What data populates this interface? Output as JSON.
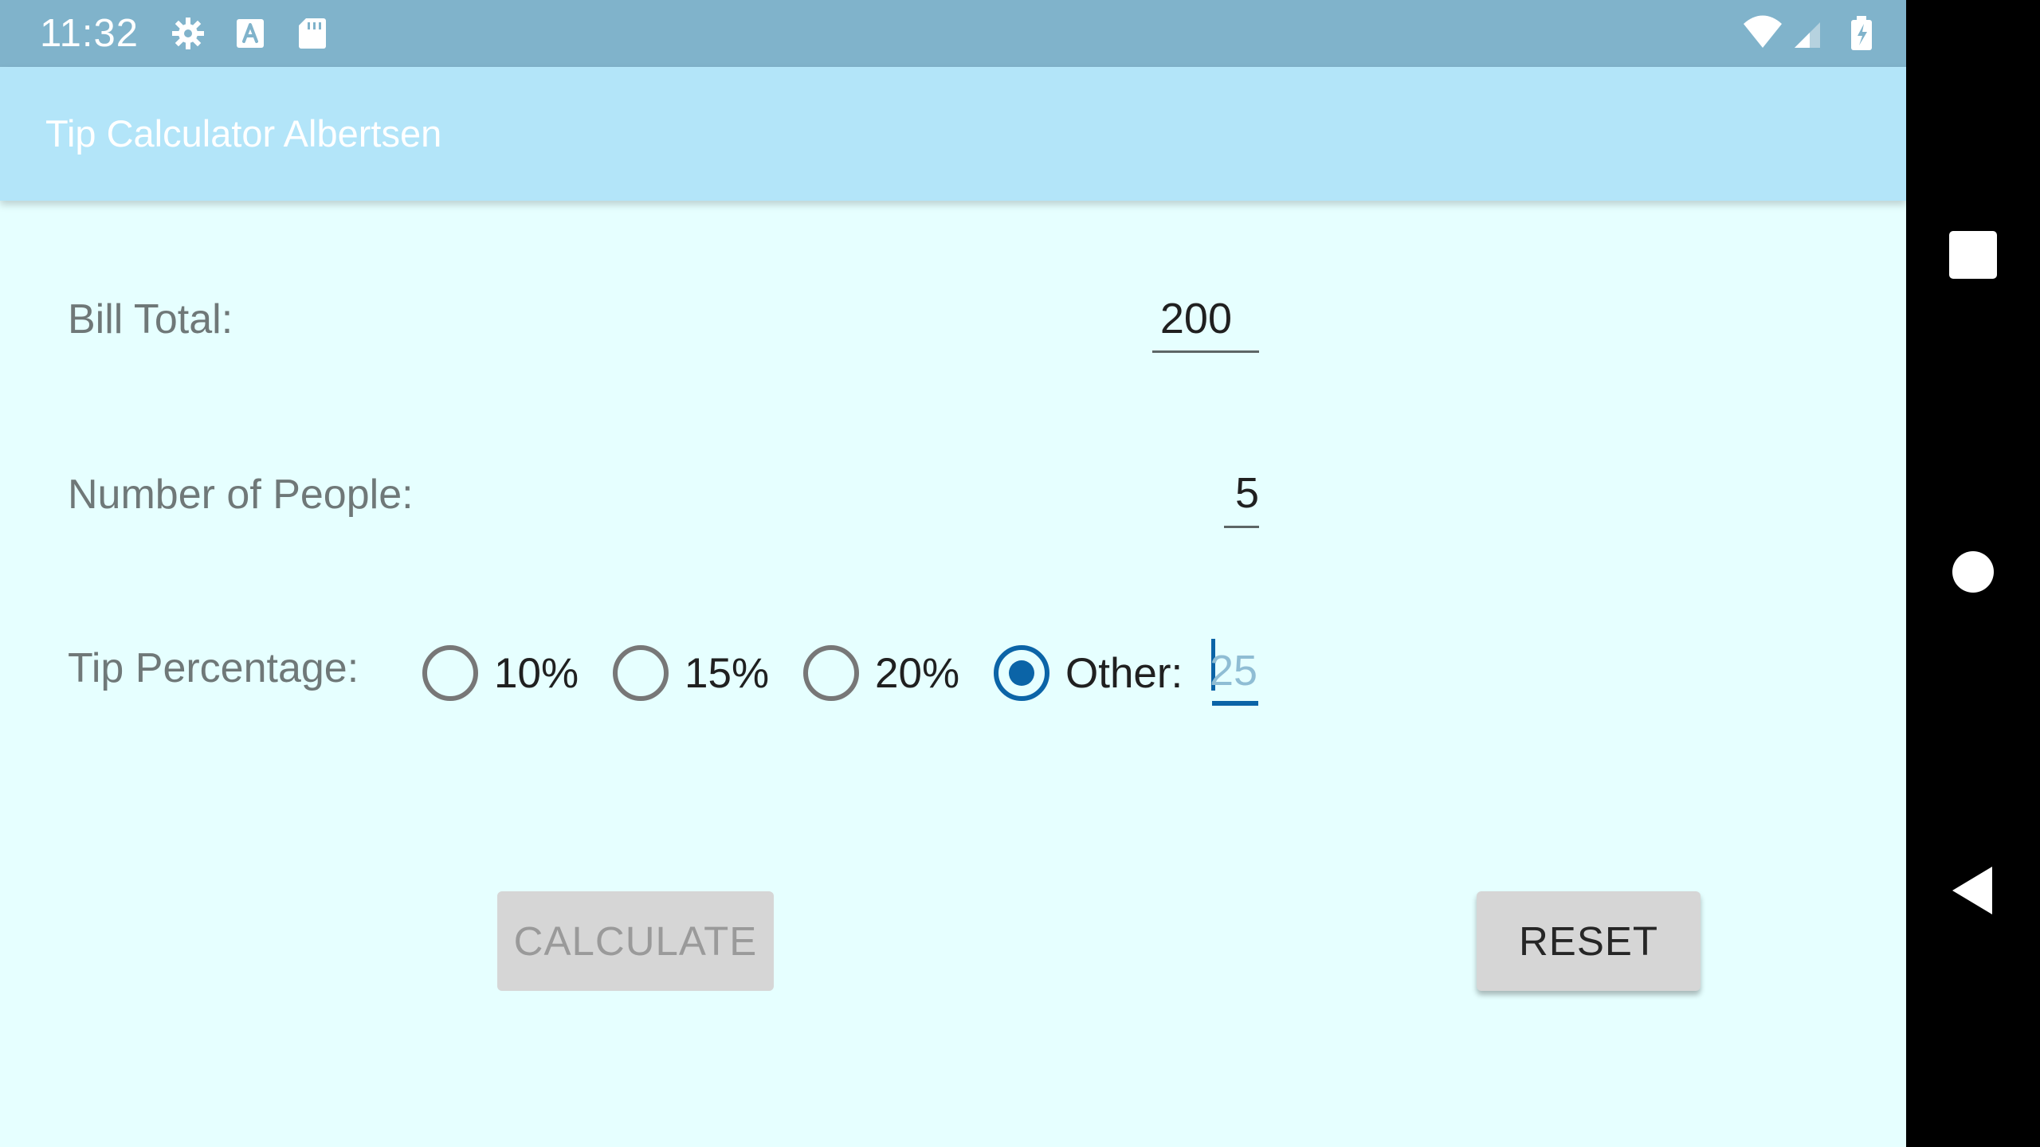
{
  "status_bar": {
    "time": "11:32",
    "icons": [
      "gear-icon",
      "font-icon",
      "sd-card-icon",
      "wifi-icon",
      "cellular-signal-icon",
      "battery-charging-icon"
    ]
  },
  "app": {
    "title": "Tip Calculator Albertsen"
  },
  "form": {
    "bill_total": {
      "label": "Bill Total:",
      "value": "200"
    },
    "people": {
      "label": "Number of People:",
      "value": "5"
    },
    "tip": {
      "label": "Tip Percentage:",
      "options": [
        {
          "label": "10%",
          "checked": false
        },
        {
          "label": "15%",
          "checked": false
        },
        {
          "label": "20%",
          "checked": false
        },
        {
          "label": "Other:",
          "checked": true
        }
      ],
      "other_placeholder": "25"
    }
  },
  "buttons": {
    "calculate": "CALCULATE",
    "reset": "RESET",
    "calculate_enabled": false
  },
  "navigation": {
    "buttons": [
      "recents-icon",
      "home-icon",
      "back-icon"
    ]
  },
  "colors": {
    "status_bar": "#80b3cb",
    "app_bar": "#b3e5f9",
    "background": "#e6ffff",
    "accent": "#0b64a7",
    "button": "#d6d6d6"
  }
}
